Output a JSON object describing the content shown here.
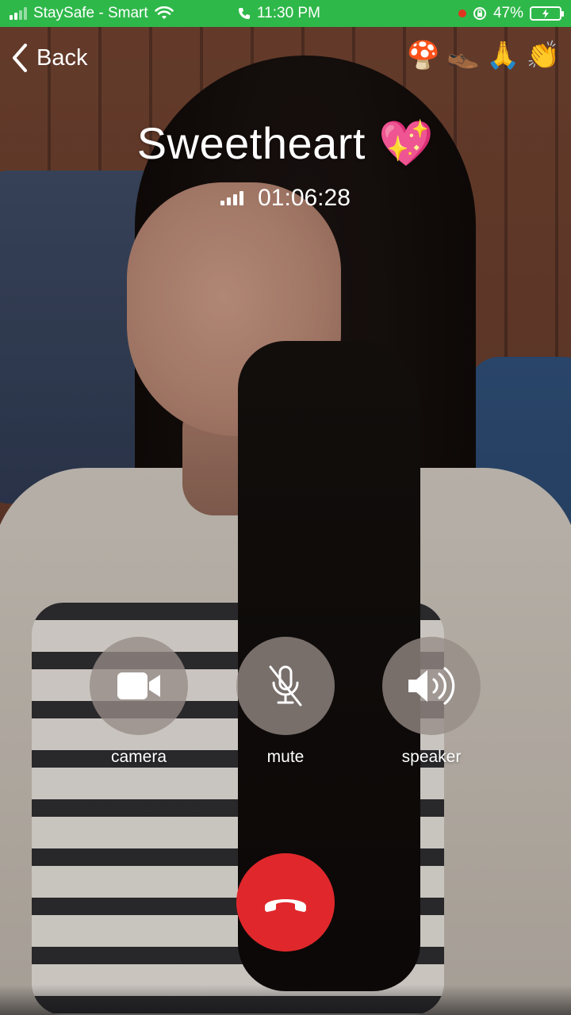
{
  "status_bar": {
    "carrier": "StaySafe - Smart",
    "time": "11:30 PM",
    "battery": "47%",
    "bar_color": "#2fb84a"
  },
  "nav": {
    "back_label": "Back",
    "emojis": [
      "🍄",
      "👞",
      "🙏",
      "👏"
    ]
  },
  "call": {
    "name": "Sweetheart 💖",
    "duration": "01:06:28"
  },
  "controls": [
    {
      "label": "camera",
      "icon": "video-camera-icon"
    },
    {
      "label": "mute",
      "icon": "microphone-muted-icon"
    },
    {
      "label": "speaker",
      "icon": "speaker-icon"
    }
  ],
  "end_call": {
    "icon": "hang-up-icon",
    "color": "#e0282c"
  }
}
